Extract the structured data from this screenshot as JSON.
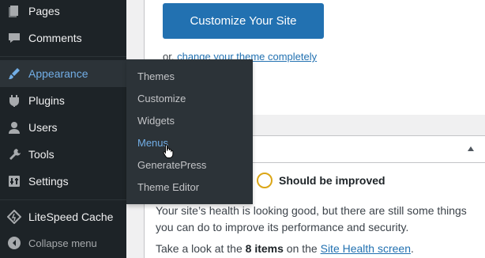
{
  "sidebar": {
    "items": [
      {
        "label": "Pages",
        "icon": "pages-icon"
      },
      {
        "label": "Comments",
        "icon": "comments-icon"
      },
      {
        "label": "Appearance",
        "icon": "appearance-icon"
      },
      {
        "label": "Plugins",
        "icon": "plugins-icon"
      },
      {
        "label": "Users",
        "icon": "users-icon"
      },
      {
        "label": "Tools",
        "icon": "tools-icon"
      },
      {
        "label": "Settings",
        "icon": "settings-icon"
      },
      {
        "label": "LiteSpeed Cache",
        "icon": "litespeed-icon"
      },
      {
        "label": "Collapse menu",
        "icon": "collapse-icon"
      }
    ]
  },
  "flyout": {
    "items": [
      "Themes",
      "Customize",
      "Widgets",
      "Menus",
      "GeneratePress",
      "Theme Editor"
    ],
    "current": "Menus"
  },
  "welcome": {
    "cta_label": "Customize Your Site",
    "or_text": "or,",
    "theme_link": "change your theme completely"
  },
  "health": {
    "status": "Should be improved",
    "para1": "Your site’s health is looking good, but there are still some things you can do to improve its performance and security.",
    "para2_pre": "Take a look at the",
    "para2_bold": "8 items",
    "para2_mid": "on the",
    "para2_link": "Site Health screen",
    "para2_end": "."
  },
  "colors": {
    "sidebar_bg": "#1d2327",
    "flyout_bg": "#2c3338",
    "accent": "#72aee6",
    "button": "#2271b1",
    "status_ring": "#dba617"
  }
}
